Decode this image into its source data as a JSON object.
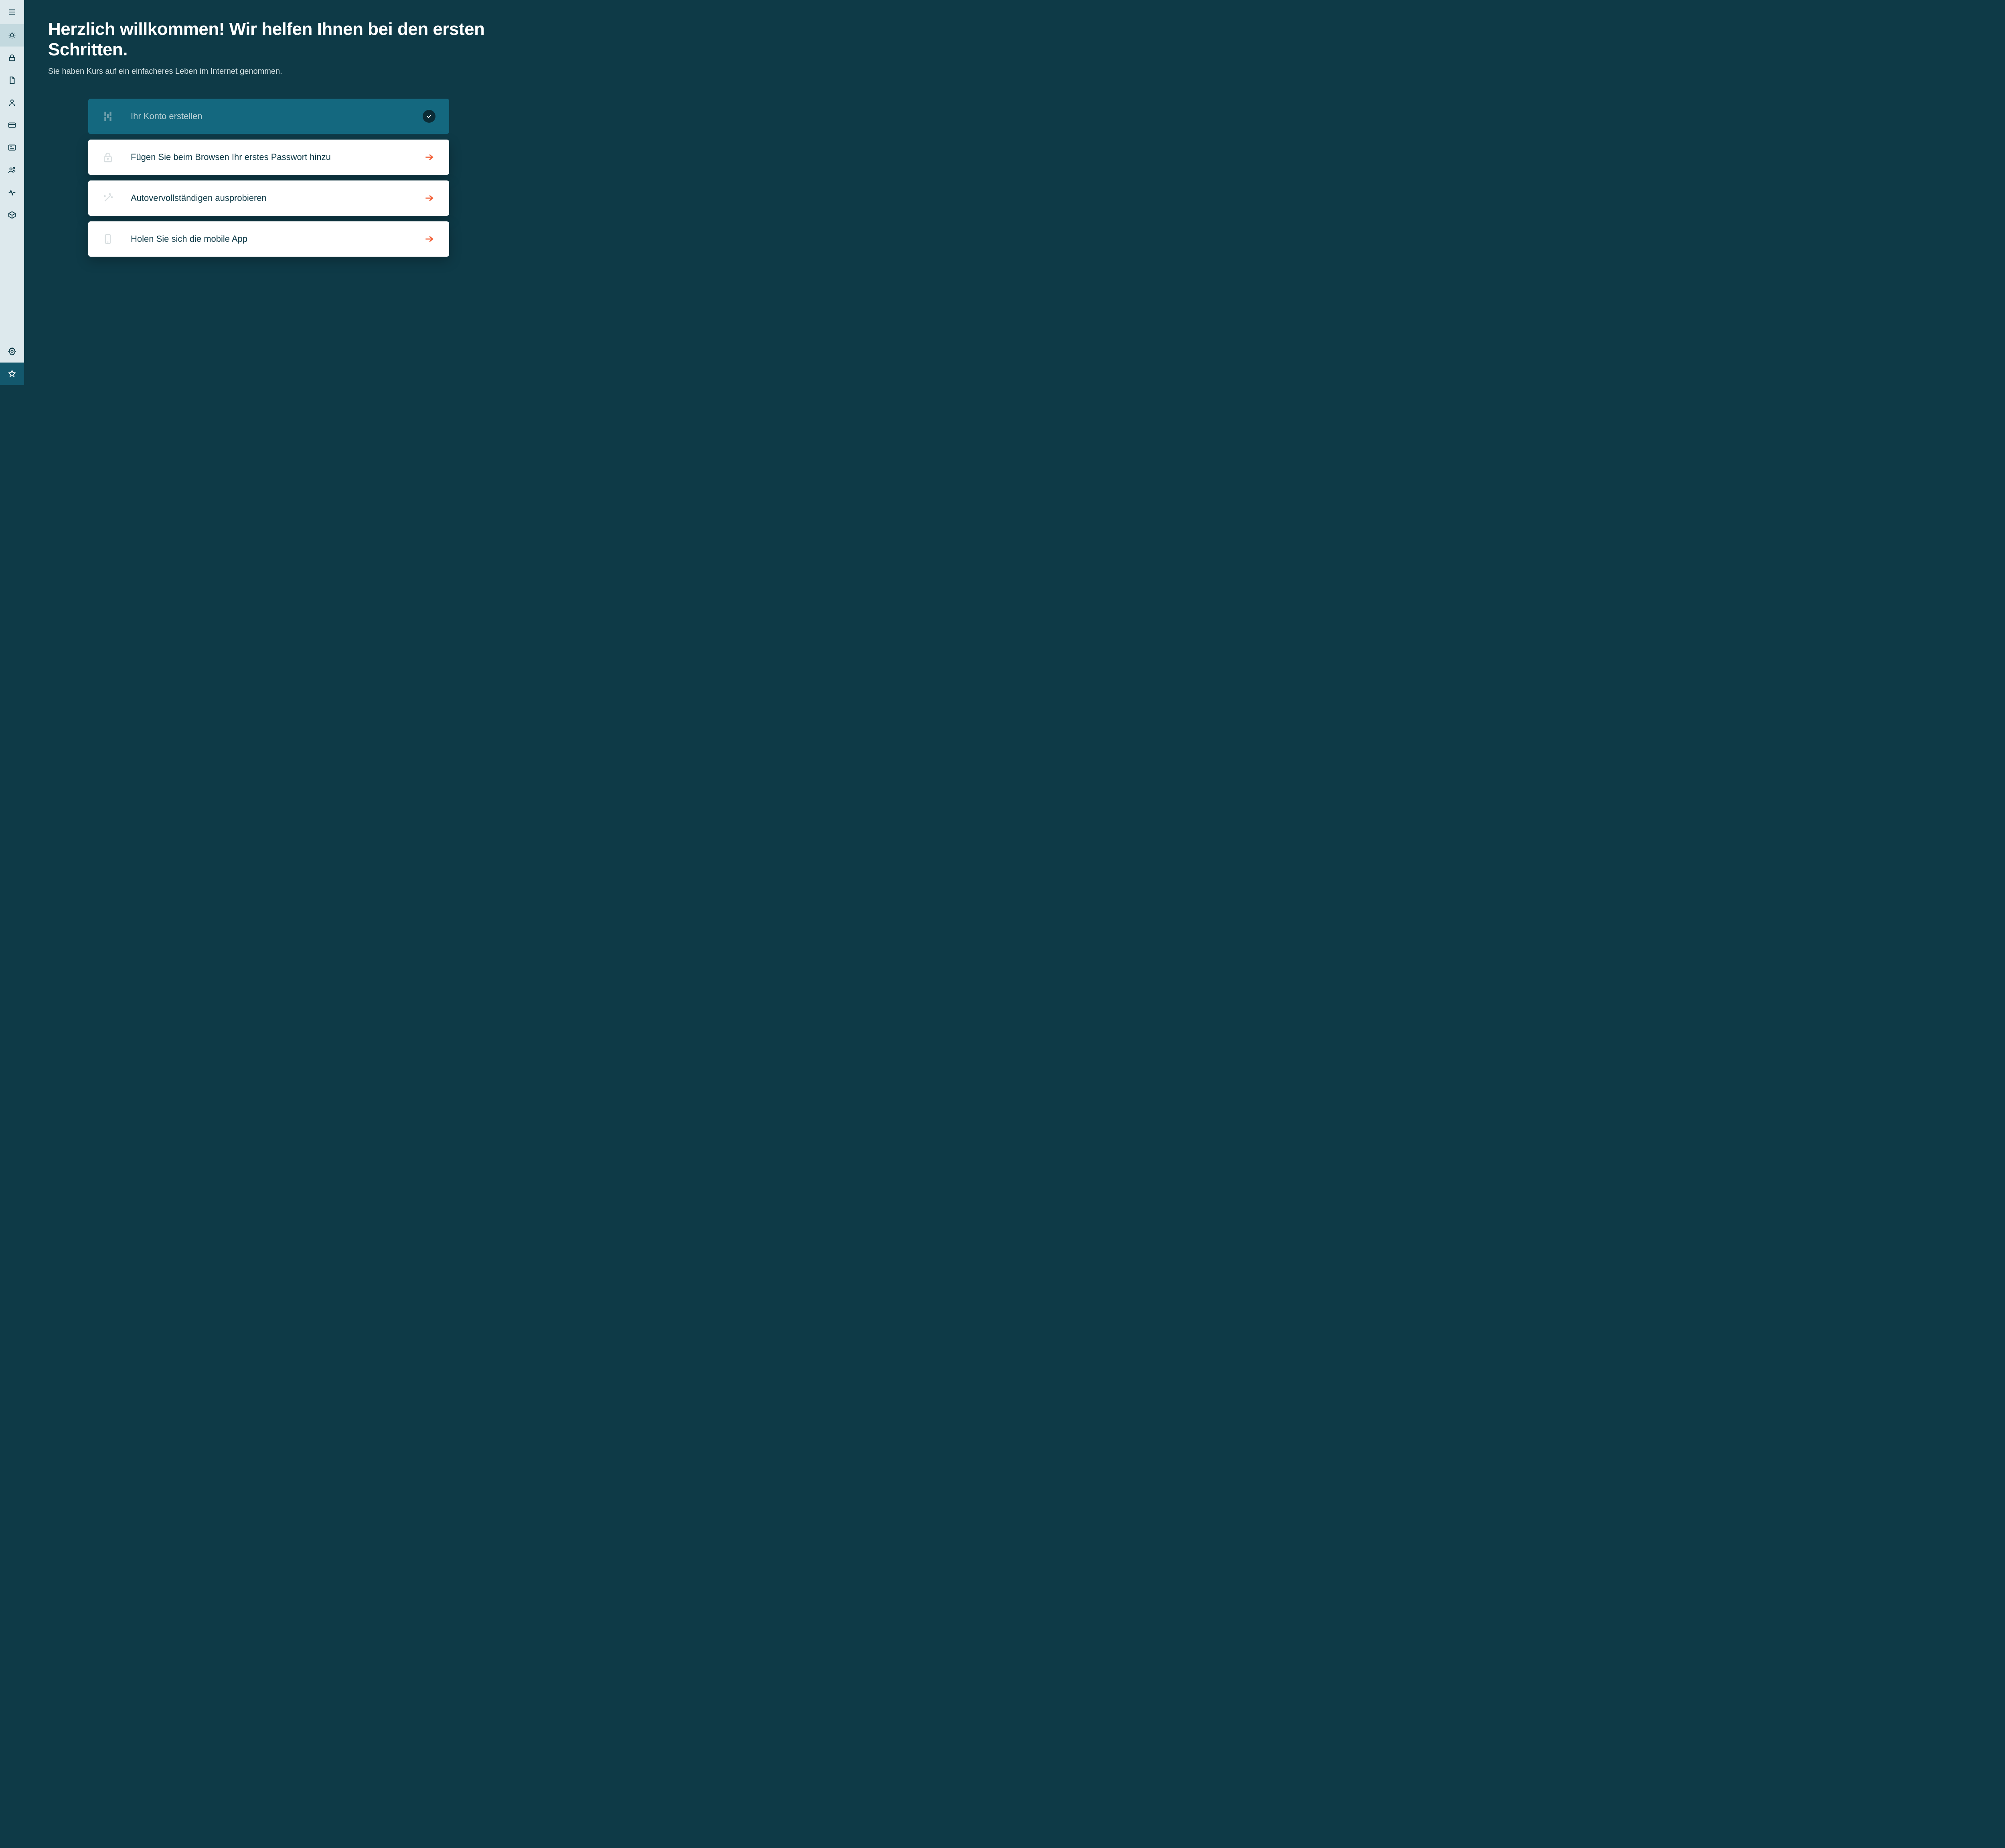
{
  "header": {
    "title": "Herzlich willkommen! Wir helfen Ihnen bei den ersten Schritten.",
    "subtitle": "Sie haben Kurs auf ein einfacheres Leben im Internet genommen."
  },
  "onboarding": {
    "steps": [
      {
        "label": "Ihr Konto erstellen",
        "completed": true
      },
      {
        "label": "Fügen Sie beim Browsen Ihr erstes Passwort hinzu",
        "completed": false
      },
      {
        "label": "Autovervollständigen ausprobieren",
        "completed": false
      },
      {
        "label": "Holen Sie sich die mobile App",
        "completed": false
      }
    ]
  },
  "colors": {
    "accent": "#f25d34",
    "bg": "#0e3a47",
    "sidebar": "#dde9ed",
    "cardDone": "#14687f"
  }
}
